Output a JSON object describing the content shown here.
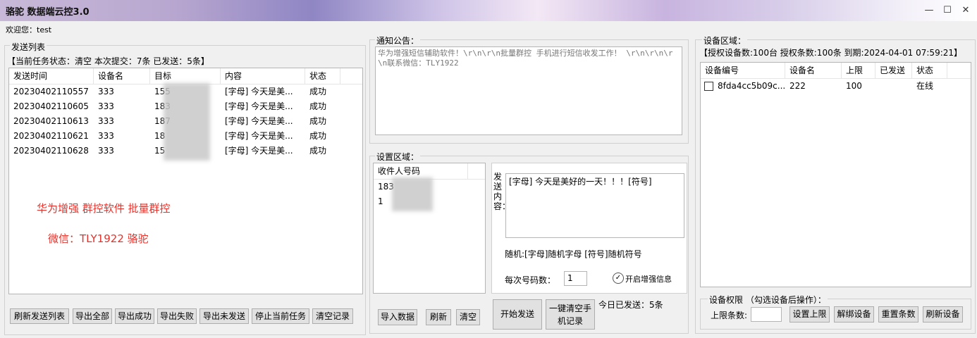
{
  "window": {
    "title": "骆驼 数据端云控3.0",
    "min": "—",
    "max": "☐",
    "close": "✕"
  },
  "welcome": "欢迎您：test",
  "send_list": {
    "title": "发送列表",
    "status_line": "【当前任务状态：清空  本次提交：7条  已发送：5条】",
    "columns": [
      "发送时间",
      "设备名",
      "目标",
      "内容",
      "状态"
    ],
    "rows": [
      {
        "time": "20230402110557",
        "device": "333",
        "target": "155",
        "content": "[字母] 今天是美...",
        "status": "成功"
      },
      {
        "time": "20230402110605",
        "device": "333",
        "target": "183",
        "content": "[字母] 今天是美...",
        "status": "成功"
      },
      {
        "time": "20230402110613",
        "device": "333",
        "target": "187",
        "content": "[字母] 今天是美...",
        "status": "成功"
      },
      {
        "time": "20230402110621",
        "device": "333",
        "target": "18",
        "content": "[字母] 今天是美...",
        "status": "成功"
      },
      {
        "time": "20230402110628",
        "device": "333",
        "target": "15",
        "content": "[字母] 今天是美...",
        "status": "成功"
      }
    ],
    "promo1": "华为增强 群控软件   批量群控",
    "promo2": "微信：TLY1922   骆驼",
    "buttons": [
      "刷新发送列表",
      "导出全部",
      "导出成功",
      "导出失败",
      "导出未发送",
      "停止当前任务",
      "清空记录"
    ]
  },
  "notice": {
    "title": "通知公告：",
    "text": "华为增强短信辅助软件！\\r\\n\\r\\n批量群控 手机进行短信收发工作！ \\r\\n\\r\\n\\r\\n联系微信：TLY1922"
  },
  "settings": {
    "title": "设置区域：",
    "recipient_header": "收件人号码",
    "recipients": [
      "183",
      "1"
    ],
    "content_label": "发送内容：",
    "content_value": "[字母] 今天是美好的一天！！！[符号]",
    "random_hint": "随机:[字母]随机字母 [符号]随机符号",
    "per_count_label": "每次号码数：",
    "per_count_value": "1",
    "enhance_label": "开启增强信息",
    "buttons": {
      "import": "导入数据",
      "refresh": "刷新",
      "clear": "清空",
      "start": "开始发送",
      "clear_phone": "一键清空手机记录"
    },
    "today_sent": "今日已发送：5条"
  },
  "devices": {
    "title": "设备区域：",
    "auth_line": "【授权设备数:100台 授权条数:100条 到期:2024-04-01 07:59:21】",
    "columns": [
      "设备编号",
      "设备名",
      "上限",
      "已发送",
      "状态"
    ],
    "rows": [
      {
        "id": "8fda4cc5b09c...",
        "name": "222",
        "limit": "100",
        "sent": "",
        "status": "在线"
      }
    ],
    "perm_title": "设备权限 （勾选设备后操作）：",
    "limit_label": "上限条数:",
    "buttons": [
      "设置上限",
      "解绑设备",
      "重置条数",
      "刷新设备"
    ]
  },
  "colors": {
    "promo": "#e8312a",
    "panel_border": "#d0d0d0"
  }
}
